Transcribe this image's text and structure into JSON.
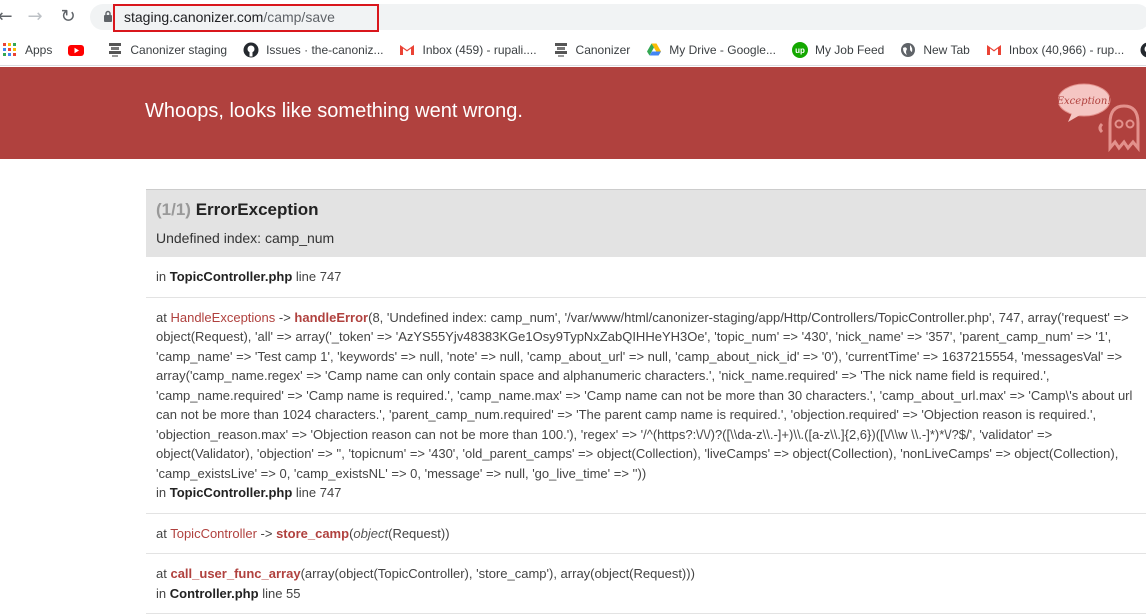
{
  "browser": {
    "url_host": "staging.canonizer.com",
    "url_path": "/camp/save",
    "back_icon": "←",
    "forward_icon": "→",
    "reload_icon": "↻"
  },
  "bookmarks": [
    {
      "label": "Apps",
      "icon": "apps-grid-icon",
      "color": "#4285f4"
    },
    {
      "label": "",
      "icon": "youtube-icon",
      "color": "#ff0000"
    },
    {
      "label": "Canonizer staging",
      "icon": "canonizer-icon",
      "color": "#444444"
    },
    {
      "label": "Issues · the-canoniz...",
      "icon": "github-icon",
      "color": "#24292e"
    },
    {
      "label": "Inbox (459) - rupali....",
      "icon": "gmail-icon",
      "color": "#ea4335"
    },
    {
      "label": "Canonizer",
      "icon": "canonizer-icon",
      "color": "#444444"
    },
    {
      "label": "My Drive - Google...",
      "icon": "google-drive-icon",
      "color": "#34a853"
    },
    {
      "label": "My Job Feed",
      "icon": "upwork-icon",
      "color": "#14a800"
    },
    {
      "label": "New Tab",
      "icon": "globe-icon",
      "color": "#5f6368"
    },
    {
      "label": "Inbox (40,966) - rup...",
      "icon": "gmail-icon",
      "color": "#ea4335"
    },
    {
      "label": "",
      "icon": "github-icon",
      "color": "#24292e"
    }
  ],
  "header": {
    "title": "Whoops, looks like something went wrong.",
    "ghost_label": "Exception!"
  },
  "exception": {
    "count": "(1/1)",
    "name": "ErrorException",
    "message": "Undefined index: camp_num"
  },
  "frames": {
    "f0": {
      "prefix": "in ",
      "file": "TopicController.php",
      "line_text": " line 747"
    },
    "f1": {
      "at": "at ",
      "cls": "HandleExceptions",
      "arrow": " -> ",
      "fn": "handleError",
      "args": "(8, 'Undefined index: camp_num', '/var/www/html/canonizer-staging/app/Http/Controllers/TopicController.php', 747, array('request' => object(Request), 'all' => array('_token' => 'AzYS55Yjv48383KGe1Osy9TypNxZabQIHHeYH3Oe', 'topic_num' => '430', 'nick_name' => '357', 'parent_camp_num' => '1', 'camp_name' => 'Test camp 1', 'keywords' => null, 'note' => null, 'camp_about_url' => null, 'camp_about_nick_id' => '0'), 'currentTime' => 1637215554, 'messagesVal' => array('camp_name.regex' => 'Camp name can only contain space and alphanumeric characters.', 'nick_name.required' => 'The nick name field is required.', 'camp_name.required' => 'Camp name is required.', 'camp_name.max' => 'Camp name can not be more than 30 characters.', 'camp_about_url.max' => 'Camp\\'s about url can not be more than 1024 characters.', 'parent_camp_num.required' => 'The parent camp name is required.', 'objection.required' => 'Objection reason is required.', 'objection_reason.max' => 'Objection reason can not be more than 100.'), 'regex' => '/^(https?:\\/\\/)?([\\\\da-z\\\\.-]+)\\\\.([a-z\\\\.]{2,6})([\\/\\\\w \\\\.-]*)*\\/?$/', 'validator' => object(Validator), 'objection' => '', 'topicnum' => '430', 'old_parent_camps' => object(Collection), 'liveCamps' => object(Collection), 'nonLiveCamps' => object(Collection), 'camp_existsLive' => 0, 'camp_existsNL' => 0, 'message' => null, 'go_live_time' => ''))",
      "in": "in ",
      "file": "TopicController.php",
      "line_text": " line 747"
    },
    "f2": {
      "at": "at ",
      "cls": "TopicController",
      "arrow": " -> ",
      "fn": "store_camp",
      "args_open": "(",
      "args_obj": "object",
      "args_rest": "(Request))"
    },
    "f3": {
      "at": "at ",
      "fn": "call_user_func_array",
      "args": "(array(object(TopicController), 'store_camp'), array(object(Request)))",
      "in": "in ",
      "file": "Controller.php",
      "line_text": " line 55"
    }
  }
}
